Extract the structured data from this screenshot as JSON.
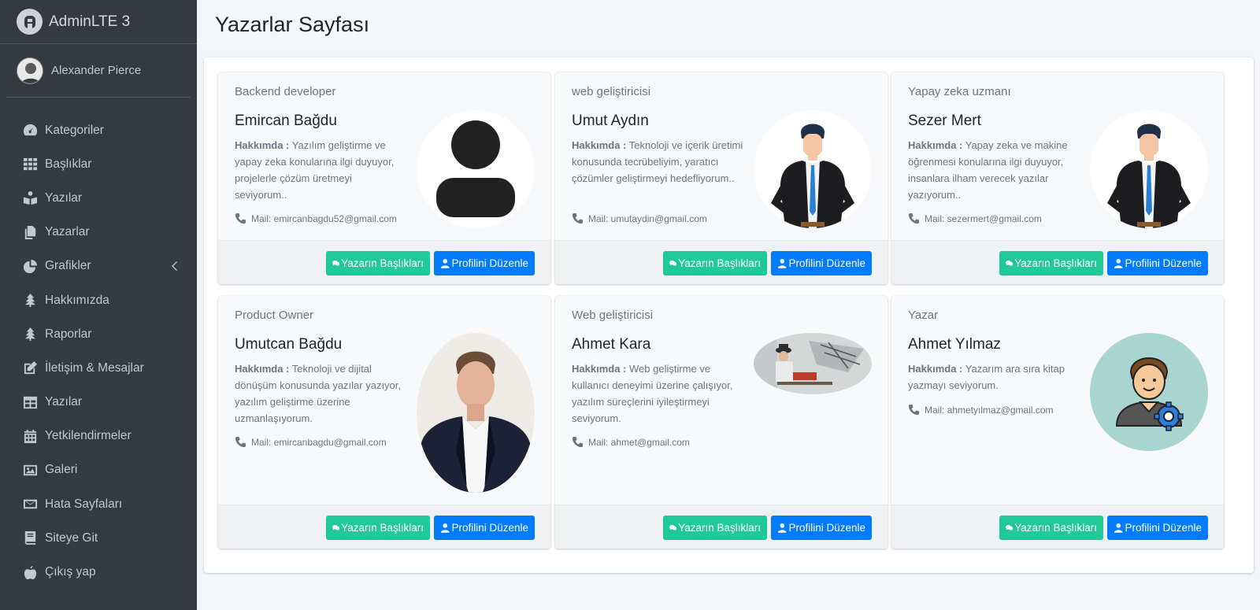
{
  "brand": {
    "title": "AdminLTE 3"
  },
  "user": {
    "name": "Alexander Pierce"
  },
  "sidebar": {
    "items": [
      {
        "label": "Kategoriler",
        "icon": "tachometer-icon"
      },
      {
        "label": "Başlıklar",
        "icon": "th-icon"
      },
      {
        "label": "Yazılar",
        "icon": "book-reader-icon"
      },
      {
        "label": "Yazarlar",
        "icon": "copy-icon"
      },
      {
        "label": "Grafikler",
        "icon": "chart-pie-icon"
      },
      {
        "label": "Hakkımızda",
        "icon": "tree-icon"
      },
      {
        "label": "Raporlar",
        "icon": "tree-icon"
      },
      {
        "label": "İletişim & Mesajlar",
        "icon": "edit-icon"
      },
      {
        "label": "Yazılar",
        "icon": "table-icon"
      },
      {
        "label": "Yetkilendirmeler",
        "icon": "calendar-icon"
      },
      {
        "label": "Galeri",
        "icon": "image-icon"
      },
      {
        "label": "Hata Sayfaları",
        "icon": "envelope-icon"
      },
      {
        "label": "Siteye Git",
        "icon": "book-icon"
      },
      {
        "label": "Çıkış yap",
        "icon": "apple-icon"
      }
    ]
  },
  "page": {
    "title": "Yazarlar Sayfası"
  },
  "labels": {
    "about": "Hakkımda :",
    "mail_prefix": "Mail: "
  },
  "buttons": {
    "titles": "Yazarın Başlıkları",
    "edit": "Profilini Düzenle"
  },
  "authors": [
    {
      "role": "Backend developer",
      "name": "Emircan Bağdu",
      "about": "Yazılım geliştirme ve yapay zeka konularına ilgi duyuyor, projelerle çözüm üretmeyi seviyorum..",
      "mail": "Mail: emircanbagdu52@gmail.com",
      "avatar": "silhouette-avatar"
    },
    {
      "role": "web geliştiricisi",
      "name": "Umut Aydın",
      "about": "Teknoloji ve içerik üretimi konusunda tecrübeliyim, yaratıcı çözümler geliştirmeyi hedefliyorum..",
      "mail": "Mail: umutaydin@gmail.com",
      "avatar": "businessman-avatar"
    },
    {
      "role": "Yapay zeka uzmanı",
      "name": "Sezer Mert",
      "about": "Yapay zeka ve makine öğrenmesi konularına ilgi duyuyor, insanlara ilham verecek yazılar yazıyorum..",
      "mail": "Mail: sezermert@gmail.com",
      "avatar": "businessman-avatar"
    },
    {
      "role": "Product Owner",
      "name": "Umutcan Bağdu",
      "about": "Teknoloji ve dijital dönüşüm konusunda yazılar yazıyor, yazılım geliştirme üzerine uzmanlaşıyorum.",
      "mail": "Mail: emircanbagdu@gmail.com",
      "avatar": "portrait-photo"
    },
    {
      "role": "Web geliştiricisi",
      "name": "Ahmet Kara",
      "about": "Web geliştirme ve kullanıcı deneyimi üzerine çalışıyor, yazılım süreçlerini iyileştirmeyi seviyorum.",
      "mail": "Mail: ahmet@gmail.com",
      "avatar": "typewriter-photo"
    },
    {
      "role": "Yazar",
      "name": "Ahmet Yılmaz",
      "about": "Yazarım ara sıra kitap yazmayı seviyorum.",
      "mail": "Mail: ahmetyılmaz@gmail.com",
      "avatar": "user-gear-avatar"
    }
  ]
}
